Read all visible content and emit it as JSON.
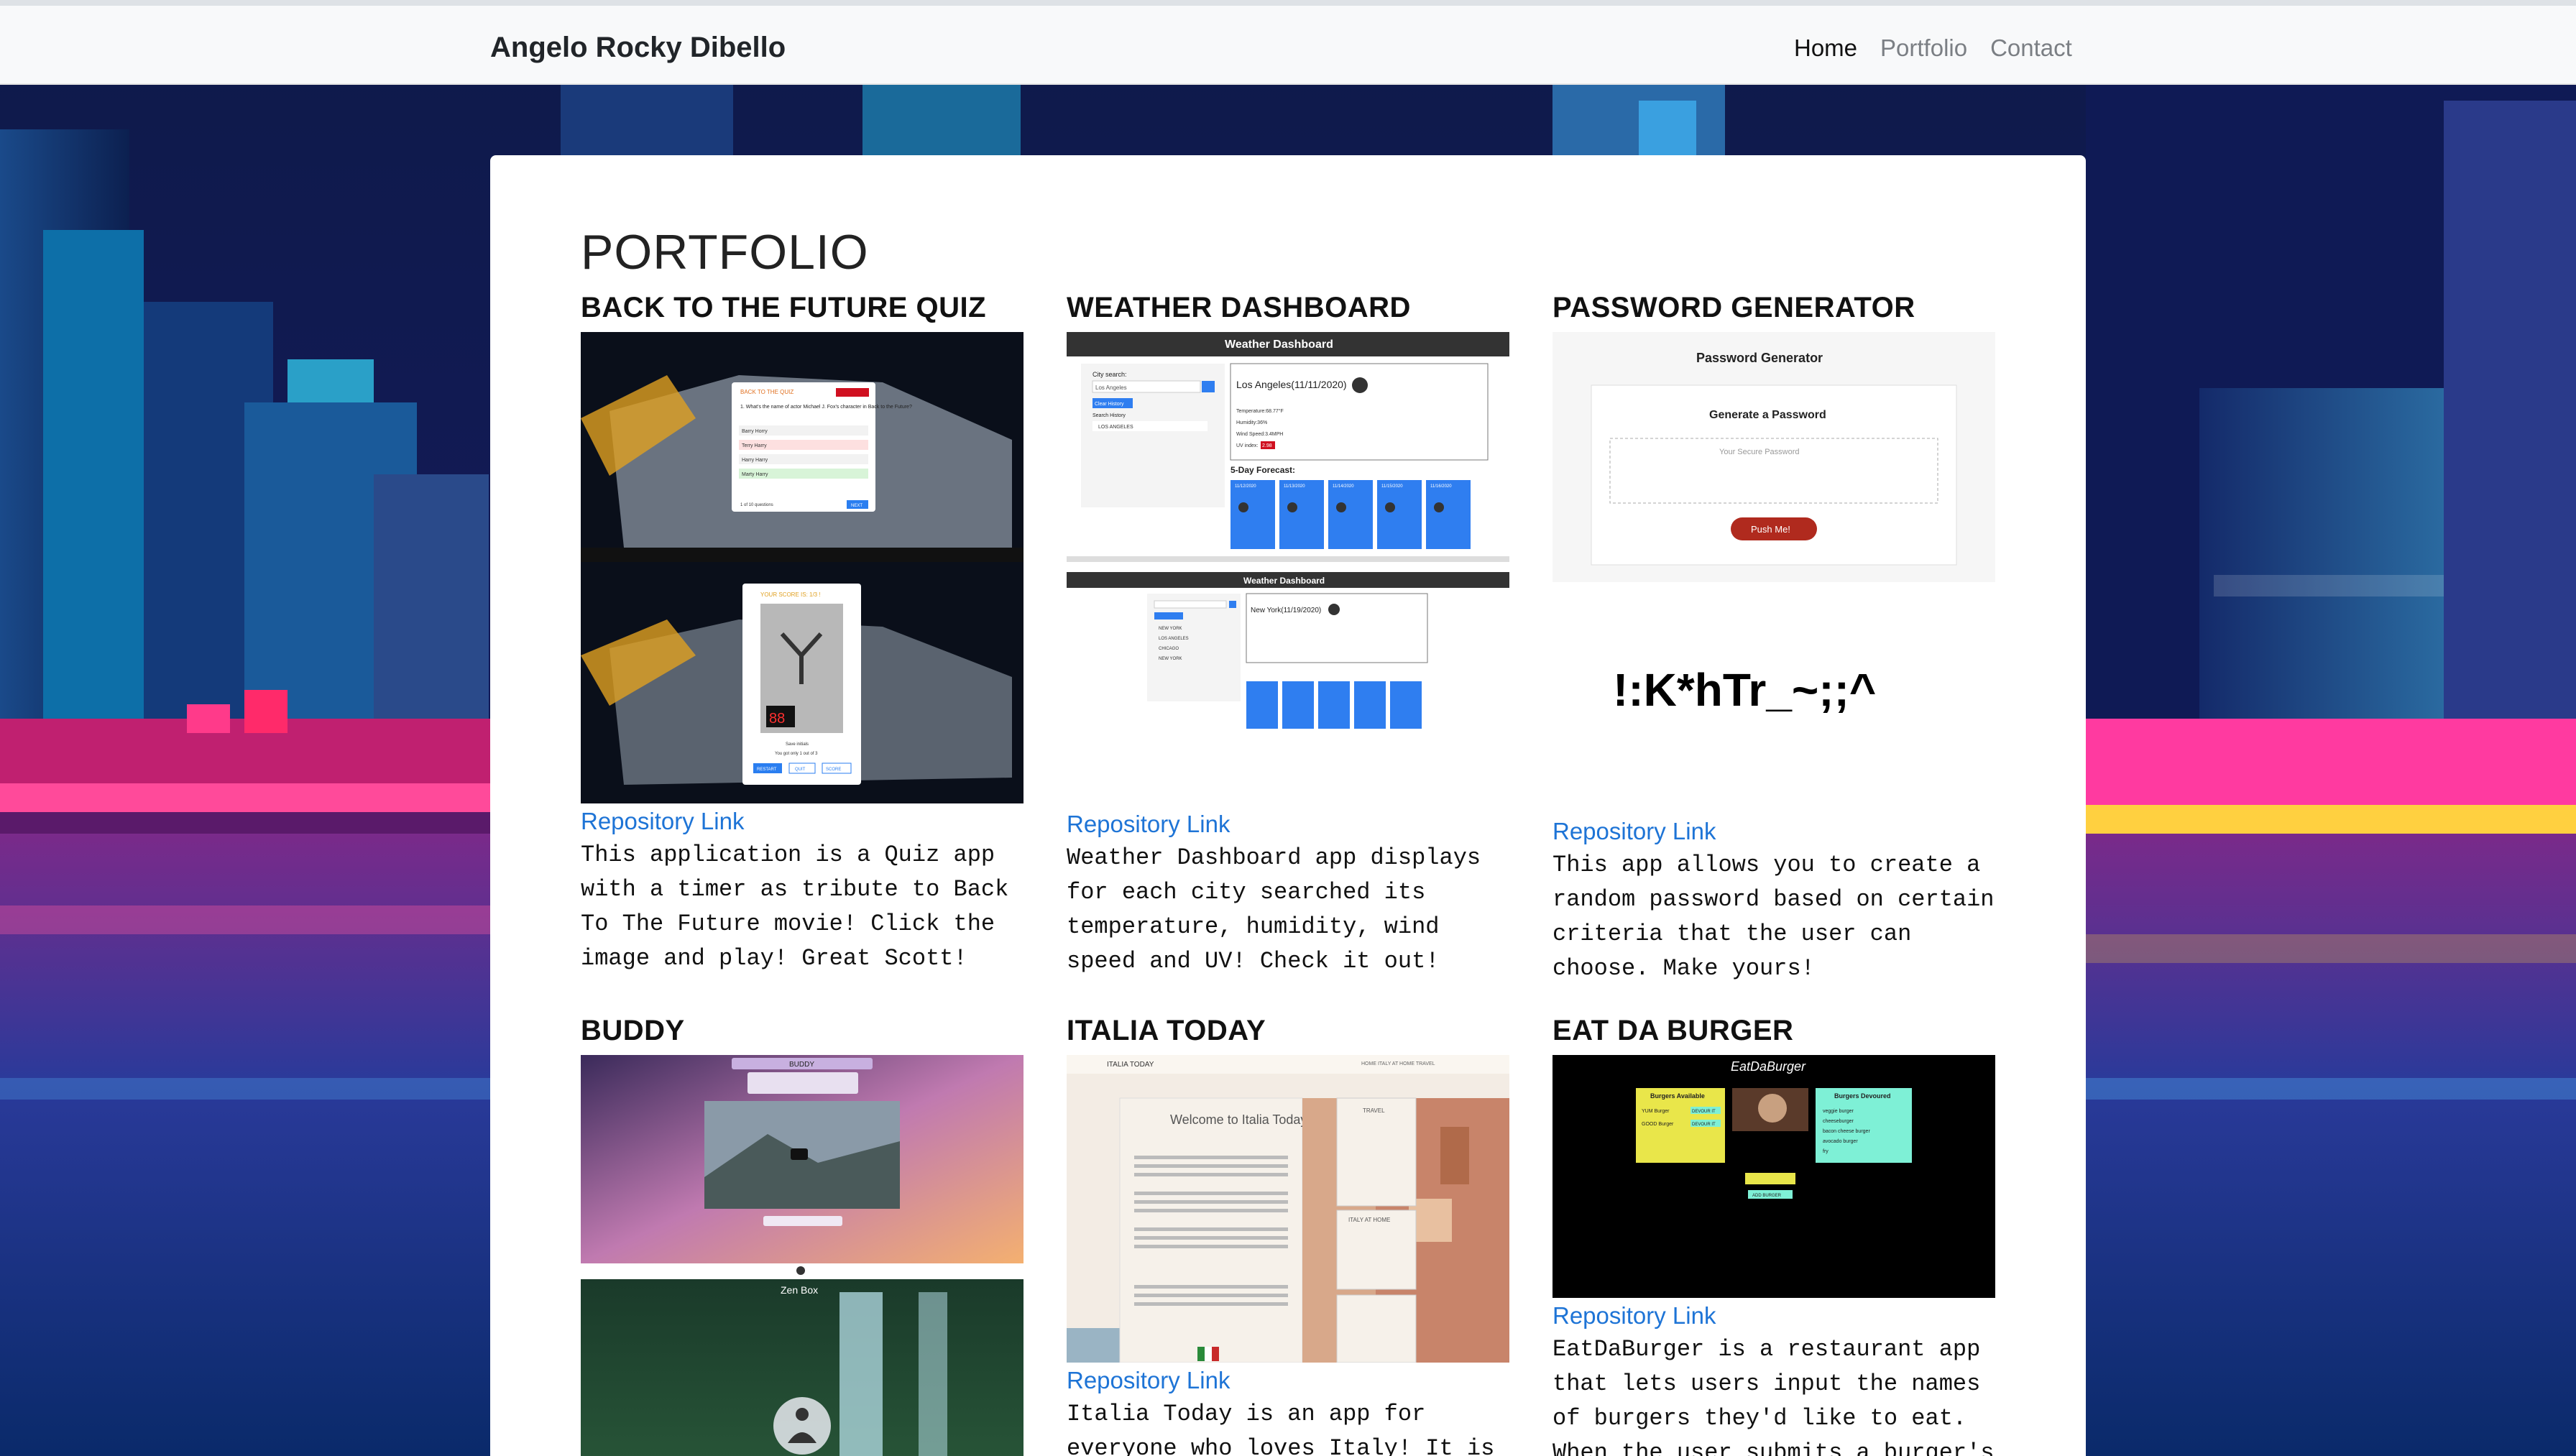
{
  "nav": {
    "brand": "Angelo Rocky Dibello",
    "links": [
      "Home",
      "Portfolio",
      "Contact"
    ]
  },
  "page": {
    "title": "PORTFOLIO"
  },
  "projects": [
    {
      "title": "BACK TO THE FUTURE QUIZ",
      "link": "Repository Link",
      "description": "This application is a Quiz app with a timer as tribute to Back To The Future movie! Click the image and play! Great Scott!",
      "shot": {
        "quiz_title": "BACK TO THE QUIZ",
        "question": "1. What's the name of actor Michael J. Fox's character in Back to the Future?",
        "options": [
          "Barry Horry",
          "Terry Harry",
          "Harry Harry",
          "Marty Harry"
        ],
        "footer": "1 of 10 questions",
        "next_button": "NEXT",
        "score": "YOUR SCORE IS: 1/3 !",
        "score_display": "88",
        "save_label": "Save initials",
        "score_note": "You got only 1 out of 3",
        "buttons": [
          "RESTART",
          "QUIT",
          "SCORE"
        ]
      }
    },
    {
      "title": "WEATHER DASHBOARD",
      "link": "Repository Link",
      "description": "Weather Dashboard app displays for each city searched its temperature, humidity, wind speed and UV! Check it out!",
      "shot": {
        "header": "Weather Dashboard",
        "search_label": "City search:",
        "search_value": "Los Angeles",
        "clear_button": "Clear History",
        "history_label": "Search History",
        "history": [
          "LOS ANGELES"
        ],
        "current": "Los Angeles(11/11/2020)",
        "stats": [
          "Temperature:68.77°F",
          "Humidity:36%",
          "Wind Speed:3.4MPH",
          "UV index:"
        ],
        "uv_value": "2.98",
        "forecast_label": "5-Day Forecast:",
        "forecast_dates": [
          "11/12/2020",
          "11/13/2020",
          "11/14/2020",
          "11/15/2020",
          "11/16/2020"
        ],
        "header2": "Weather Dashboard",
        "current2": "New York(11/19/2020)",
        "history2": [
          "NEW YORK",
          "LOS ANGELES",
          "CHICAGO",
          "NEW YORK"
        ]
      }
    },
    {
      "title": "PASSWORD GENERATOR",
      "link": "Repository Link",
      "description": "This app allows you to create a random password based on certain criteria that the user can choose. Make yours!",
      "shot": {
        "app_title": "Password Generator",
        "card_title": "Generate a Password",
        "placeholder": "Your Secure Password",
        "button": "Push Me!",
        "sample": "!:K*hTr_~;;^"
      }
    },
    {
      "title": "BUDDY",
      "shot": {
        "app_name": "BUDDY",
        "zen_label": "Zen Box"
      }
    },
    {
      "title": "ITALIA TODAY",
      "link": "Repository Link",
      "description": "Italia Today is an app for everyone who loves Italy! It is",
      "shot": {
        "brand": "ITALIA TODAY",
        "nav": "HOME   ITALY AT HOME   TRAVEL",
        "welcome": "Welcome to Italia Today",
        "travel": "TRAVEL",
        "italy_home": "ITALY AT HOME"
      }
    },
    {
      "title": "EAT DA BURGER",
      "link": "Repository Link",
      "description": "EatDaBurger is a restaurant app that lets users input the names of burgers they'd like to eat. When the user submits a burger's",
      "shot": {
        "logo": "EatDaBurger",
        "available": "Burgers Available",
        "devoured": "Burgers Devoured",
        "available_items": [
          "YUM Burger",
          "GOOD Burger"
        ],
        "devour_button": "DEVOUR IT",
        "devoured_items": [
          "veggie burger",
          "cheeseburger",
          "bacon cheese burger",
          "avocado burger",
          "fry"
        ],
        "add_button": "ADD BURGER"
      }
    }
  ],
  "colors": {
    "navbar_bg": "#f8f9fa",
    "link": "#1e74d6",
    "weather_blue": "#2f7ef0",
    "push_red": "#b02a1e",
    "burger_yellow": "#e9e64a",
    "burger_cyan": "#7ef0d6"
  }
}
